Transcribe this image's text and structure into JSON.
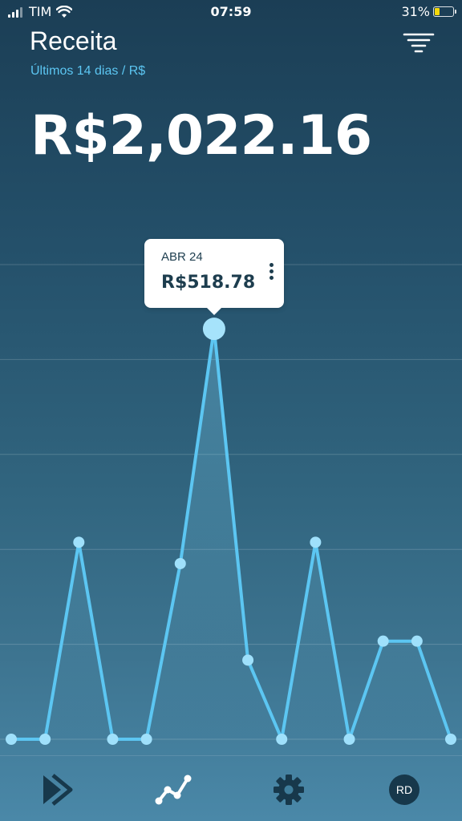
{
  "status_bar": {
    "carrier": "TIM",
    "time": "07:59",
    "battery": "31%",
    "battery_level": 0.31,
    "icons": [
      "signal-icon",
      "wifi-icon",
      "battery-icon"
    ]
  },
  "header": {
    "title": "Receita",
    "subtitle": "Últimos 14 dias / R$",
    "filter_icon": "filter-icon"
  },
  "summary": {
    "total": "R$2,022.16"
  },
  "tooltip": {
    "date": "ABR 24",
    "value": "R$518.78",
    "menu_icon": "more-vertical-icon"
  },
  "chart_data": {
    "type": "line",
    "values": [
      0,
      0,
      249,
      0,
      0,
      222,
      518.78,
      100,
      0,
      249,
      0,
      124,
      124,
      0
    ],
    "ylim": [
      0,
      600
    ],
    "highlight_index": 6,
    "grid": true,
    "colors": {
      "line": "#5cc6f2",
      "point": "#9fe0fb",
      "grid": "rgba(255,255,255,0.18)"
    }
  },
  "tab_bar": {
    "tabs": [
      {
        "name": "forward-icon",
        "active": false
      },
      {
        "name": "analytics-icon",
        "active": true
      },
      {
        "name": "settings-icon",
        "active": false
      },
      {
        "name": "avatar",
        "active": false
      }
    ],
    "avatar_initials": "RD"
  },
  "colors": {
    "accent": "#5cc6f2",
    "background_top": "#1b3e55",
    "background_bottom": "#4a88a8",
    "dark_icon": "#17384b"
  }
}
